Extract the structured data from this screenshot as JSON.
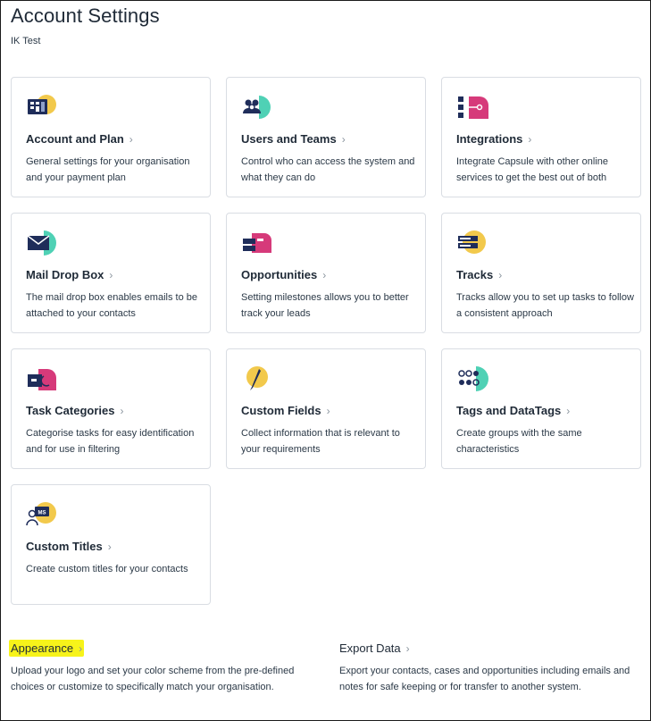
{
  "header": {
    "title": "Account Settings",
    "subtitle": "IK Test"
  },
  "cards": [
    {
      "title": "Account and Plan",
      "desc": "General settings for your organisation and your payment plan",
      "icon": "account-plan-icon",
      "accent": "#f2c94c"
    },
    {
      "title": "Users and Teams",
      "desc": "Control who can access the system and what they can do",
      "icon": "users-teams-icon",
      "accent": "#4fd1b5"
    },
    {
      "title": "Integrations",
      "desc": "Integrate Capsule with other online services to get the best out of both",
      "icon": "integrations-icon",
      "accent": "#d63a7a"
    },
    {
      "title": "Mail Drop Box",
      "desc": "The mail drop box enables emails to be attached to your contacts",
      "icon": "mail-icon",
      "accent": "#4fd1b5"
    },
    {
      "title": "Opportunities",
      "desc": "Setting milestones allows you to better track your leads",
      "icon": "opportunities-icon",
      "accent": "#d63a7a"
    },
    {
      "title": "Tracks",
      "desc": "Tracks allow you to set up tasks to follow a consistent approach",
      "icon": "tracks-icon",
      "accent": "#f2c94c"
    },
    {
      "title": "Task Categories",
      "desc": "Categorise tasks for easy identification and for use in filtering",
      "icon": "task-categories-icon",
      "accent": "#d63a7a"
    },
    {
      "title": "Custom Fields",
      "desc": "Collect information that is relevant to your requirements",
      "icon": "custom-fields-icon",
      "accent": "#f2c94c"
    },
    {
      "title": "Tags and DataTags",
      "desc": "Create groups with the same characteristics",
      "icon": "tags-icon",
      "accent": "#4fd1b5"
    },
    {
      "title": "Custom Titles",
      "desc": "Create custom titles for your contacts",
      "icon": "custom-titles-icon",
      "accent": "#f2c94c",
      "icon_text": "MS"
    }
  ],
  "chevron": "›",
  "appearance": {
    "title": "Appearance",
    "desc": "Upload your logo and set your color scheme from the pre-defined choices or customize to specifically match your organisation.",
    "highlight_color": "#f7f31a"
  },
  "export": {
    "title": "Export Data",
    "desc": "Export your contacts, cases and opportunities including emails and notes for safe keeping or for transfer to another system."
  }
}
